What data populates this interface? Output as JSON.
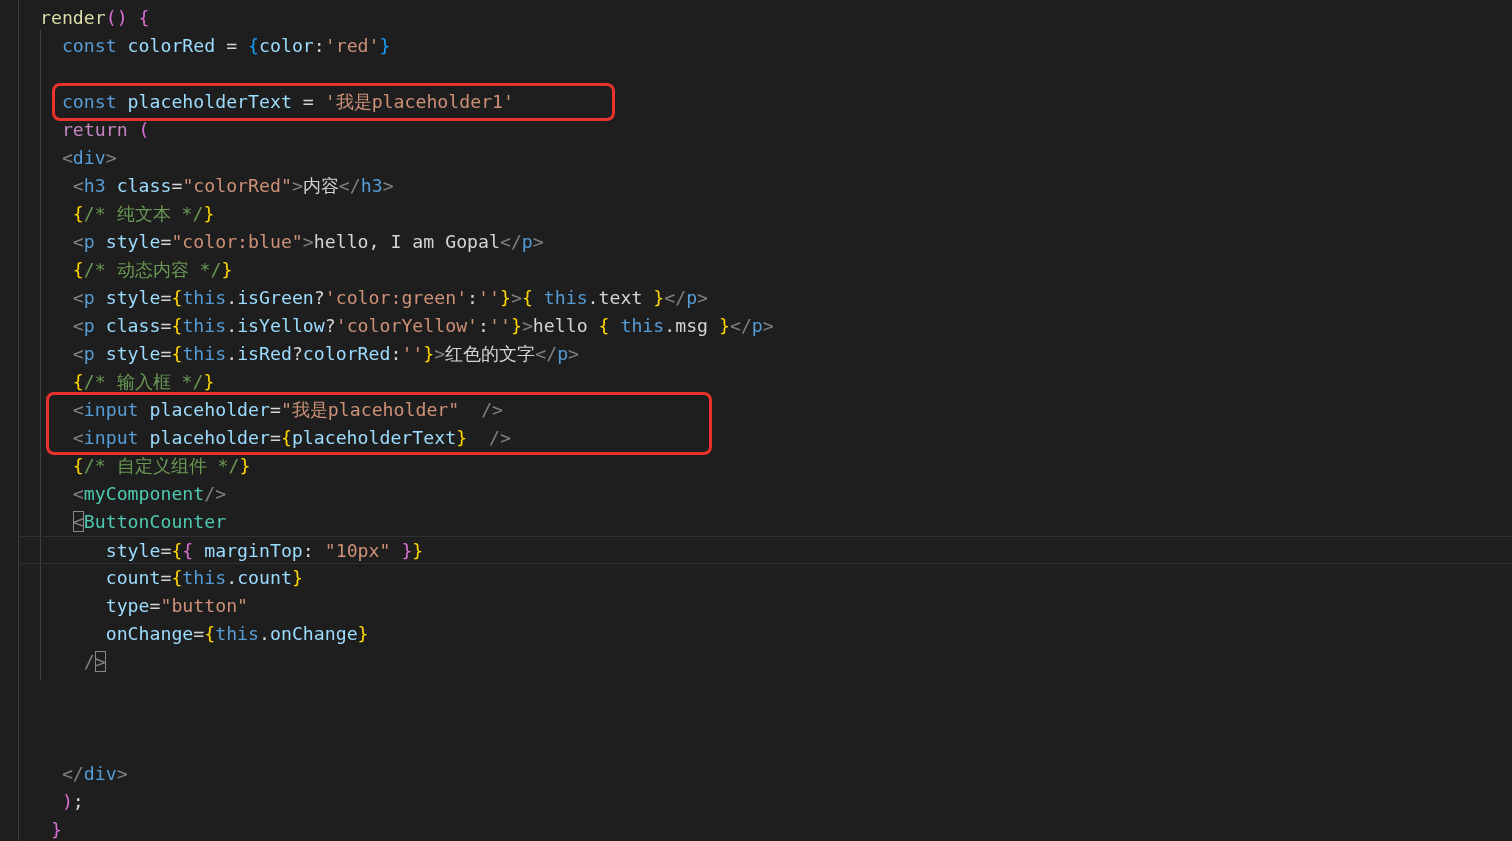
{
  "editor": {
    "lines": [
      {
        "kind": "code",
        "tokens": [
          {
            "kind": "fn",
            "text": "render"
          },
          {
            "kind": "purple",
            "text": "() "
          },
          {
            "kind": "purple",
            "text": "{"
          }
        ]
      },
      {
        "kind": "code",
        "tokens": [
          {
            "kind": "kw",
            "text": "  const "
          },
          {
            "kind": "var",
            "text": "colorRed"
          },
          {
            "kind": "plain",
            "text": " = "
          },
          {
            "kind": "brace2",
            "text": "{"
          },
          {
            "kind": "var",
            "text": "color"
          },
          {
            "kind": "plain",
            "text": ":"
          },
          {
            "kind": "str",
            "text": "'red'"
          },
          {
            "kind": "brace2",
            "text": "}"
          }
        ]
      },
      {
        "kind": "blank"
      },
      {
        "kind": "code",
        "boxed": true,
        "tokens": [
          {
            "kind": "kw",
            "text": "  const "
          },
          {
            "kind": "var",
            "text": "placeholderText"
          },
          {
            "kind": "plain",
            "text": " = "
          },
          {
            "kind": "str",
            "text": "'我是placeholder1'"
          }
        ]
      },
      {
        "kind": "code",
        "tokens": [
          {
            "kind": "ctrl",
            "text": "  return "
          },
          {
            "kind": "purple",
            "text": "("
          }
        ]
      },
      {
        "kind": "code",
        "tokens": [
          {
            "kind": "punct",
            "text": "  <"
          },
          {
            "kind": "tag",
            "text": "div"
          },
          {
            "kind": "punct",
            "text": ">"
          }
        ]
      },
      {
        "kind": "code",
        "tokens": [
          {
            "kind": "punct",
            "text": "   <"
          },
          {
            "kind": "tag",
            "text": "h3 "
          },
          {
            "kind": "var",
            "text": "class"
          },
          {
            "kind": "plain",
            "text": "="
          },
          {
            "kind": "str",
            "text": "\"colorRed\""
          },
          {
            "kind": "punct",
            "text": ">"
          },
          {
            "kind": "plain",
            "text": "内容"
          },
          {
            "kind": "punct",
            "text": "</"
          },
          {
            "kind": "tag",
            "text": "h3"
          },
          {
            "kind": "punct",
            "text": ">"
          }
        ]
      },
      {
        "kind": "code",
        "tokens": [
          {
            "kind": "yellow",
            "text": "   {"
          },
          {
            "kind": "comment",
            "text": "/* 纯文本 */"
          },
          {
            "kind": "yellow",
            "text": "}"
          }
        ]
      },
      {
        "kind": "code",
        "tokens": [
          {
            "kind": "punct",
            "text": "   <"
          },
          {
            "kind": "tag",
            "text": "p "
          },
          {
            "kind": "var",
            "text": "style"
          },
          {
            "kind": "plain",
            "text": "="
          },
          {
            "kind": "str",
            "text": "\"color:blue\""
          },
          {
            "kind": "punct",
            "text": ">"
          },
          {
            "kind": "plain",
            "text": "hello, I am Gopal"
          },
          {
            "kind": "punct",
            "text": "</"
          },
          {
            "kind": "tag",
            "text": "p"
          },
          {
            "kind": "punct",
            "text": ">"
          }
        ]
      },
      {
        "kind": "code",
        "tokens": [
          {
            "kind": "yellow",
            "text": "   {"
          },
          {
            "kind": "comment",
            "text": "/* 动态内容 */"
          },
          {
            "kind": "yellow",
            "text": "}"
          }
        ]
      },
      {
        "kind": "code",
        "tokens": [
          {
            "kind": "punct",
            "text": "   <"
          },
          {
            "kind": "tag",
            "text": "p "
          },
          {
            "kind": "var",
            "text": "style"
          },
          {
            "kind": "plain",
            "text": "="
          },
          {
            "kind": "yellow",
            "text": "{"
          },
          {
            "kind": "kw",
            "text": "this"
          },
          {
            "kind": "plain",
            "text": "."
          },
          {
            "kind": "var",
            "text": "isGreen"
          },
          {
            "kind": "plain",
            "text": "?"
          },
          {
            "kind": "str",
            "text": "'color:green'"
          },
          {
            "kind": "plain",
            "text": ":"
          },
          {
            "kind": "str",
            "text": "''"
          },
          {
            "kind": "yellow",
            "text": "}"
          },
          {
            "kind": "punct",
            "text": ">"
          },
          {
            "kind": "yellow",
            "text": "{ "
          },
          {
            "kind": "kw",
            "text": "this"
          },
          {
            "kind": "plain",
            "text": ".text "
          },
          {
            "kind": "yellow",
            "text": "}"
          },
          {
            "kind": "punct",
            "text": "</"
          },
          {
            "kind": "tag",
            "text": "p"
          },
          {
            "kind": "punct",
            "text": ">"
          }
        ]
      },
      {
        "kind": "code",
        "tokens": [
          {
            "kind": "punct",
            "text": "   <"
          },
          {
            "kind": "tag",
            "text": "p "
          },
          {
            "kind": "var",
            "text": "class"
          },
          {
            "kind": "plain",
            "text": "="
          },
          {
            "kind": "yellow",
            "text": "{"
          },
          {
            "kind": "kw",
            "text": "this"
          },
          {
            "kind": "plain",
            "text": "."
          },
          {
            "kind": "var",
            "text": "isYellow"
          },
          {
            "kind": "plain",
            "text": "?"
          },
          {
            "kind": "str",
            "text": "'colorYellow'"
          },
          {
            "kind": "plain",
            "text": ":"
          },
          {
            "kind": "str",
            "text": "''"
          },
          {
            "kind": "yellow",
            "text": "}"
          },
          {
            "kind": "punct",
            "text": ">"
          },
          {
            "kind": "plain",
            "text": "hello "
          },
          {
            "kind": "yellow",
            "text": "{ "
          },
          {
            "kind": "kw",
            "text": "this"
          },
          {
            "kind": "plain",
            "text": ".msg "
          },
          {
            "kind": "yellow",
            "text": "}"
          },
          {
            "kind": "punct",
            "text": "</"
          },
          {
            "kind": "tag",
            "text": "p"
          },
          {
            "kind": "punct",
            "text": ">"
          }
        ]
      },
      {
        "kind": "code",
        "tokens": [
          {
            "kind": "punct",
            "text": "   <"
          },
          {
            "kind": "tag",
            "text": "p "
          },
          {
            "kind": "var",
            "text": "style"
          },
          {
            "kind": "plain",
            "text": "="
          },
          {
            "kind": "yellow",
            "text": "{"
          },
          {
            "kind": "kw",
            "text": "this"
          },
          {
            "kind": "plain",
            "text": "."
          },
          {
            "kind": "var",
            "text": "isRed"
          },
          {
            "kind": "plain",
            "text": "?"
          },
          {
            "kind": "var",
            "text": "colorRed"
          },
          {
            "kind": "plain",
            "text": ":"
          },
          {
            "kind": "str",
            "text": "''"
          },
          {
            "kind": "yellow",
            "text": "}"
          },
          {
            "kind": "punct",
            "text": ">"
          },
          {
            "kind": "plain",
            "text": "红色的文字"
          },
          {
            "kind": "punct",
            "text": "</"
          },
          {
            "kind": "tag",
            "text": "p"
          },
          {
            "kind": "punct",
            "text": ">"
          }
        ]
      },
      {
        "kind": "code",
        "tokens": [
          {
            "kind": "yellow",
            "text": "   {"
          },
          {
            "kind": "comment",
            "text": "/* 输入框 */"
          },
          {
            "kind": "yellow",
            "text": "}"
          }
        ]
      },
      {
        "kind": "code",
        "boxed": true,
        "tokens": [
          {
            "kind": "punct",
            "text": "   <"
          },
          {
            "kind": "tag",
            "text": "input "
          },
          {
            "kind": "var",
            "text": "placeholder"
          },
          {
            "kind": "plain",
            "text": "="
          },
          {
            "kind": "str",
            "text": "\"我是placeholder\"  "
          },
          {
            "kind": "punct",
            "text": "/>"
          }
        ]
      },
      {
        "kind": "code",
        "boxed": true,
        "tokens": [
          {
            "kind": "punct",
            "text": "   <"
          },
          {
            "kind": "tag",
            "text": "input "
          },
          {
            "kind": "var",
            "text": "placeholder"
          },
          {
            "kind": "plain",
            "text": "="
          },
          {
            "kind": "yellow",
            "text": "{"
          },
          {
            "kind": "var",
            "text": "placeholderText"
          },
          {
            "kind": "yellow",
            "text": "}  "
          },
          {
            "kind": "punct",
            "text": "/>"
          }
        ]
      },
      {
        "kind": "code",
        "tokens": [
          {
            "kind": "yellow",
            "text": "   {"
          },
          {
            "kind": "comment",
            "text": "/* 自定义组件 */"
          },
          {
            "kind": "yellow",
            "text": "}"
          }
        ]
      },
      {
        "kind": "code",
        "tokens": [
          {
            "kind": "punct",
            "text": "   <"
          },
          {
            "kind": "component",
            "text": "myComponent"
          },
          {
            "kind": "punct",
            "text": "/>"
          }
        ]
      },
      {
        "kind": "code",
        "tokens": [
          {
            "kind": "punct",
            "text": "   <",
            "match": true
          },
          {
            "kind": "component",
            "text": "ButtonCounter"
          }
        ]
      },
      {
        "kind": "code",
        "current": true,
        "tokens": [
          {
            "kind": "var",
            "text": "      style"
          },
          {
            "kind": "plain",
            "text": "="
          },
          {
            "kind": "yellow",
            "text": "{"
          },
          {
            "kind": "purple",
            "text": "{ "
          },
          {
            "kind": "var",
            "text": "marginTop"
          },
          {
            "kind": "plain",
            "text": ": "
          },
          {
            "kind": "str",
            "text": "\"10px\" "
          },
          {
            "kind": "purple",
            "text": "}"
          },
          {
            "kind": "yellow",
            "text": "}"
          }
        ]
      },
      {
        "kind": "code",
        "tokens": [
          {
            "kind": "var",
            "text": "      count"
          },
          {
            "kind": "plain",
            "text": "="
          },
          {
            "kind": "yellow",
            "text": "{"
          },
          {
            "kind": "kw",
            "text": "this"
          },
          {
            "kind": "plain",
            "text": "."
          },
          {
            "kind": "var",
            "text": "count"
          },
          {
            "kind": "yellow",
            "text": "}"
          }
        ]
      },
      {
        "kind": "code",
        "tokens": [
          {
            "kind": "var",
            "text": "      type"
          },
          {
            "kind": "plain",
            "text": "="
          },
          {
            "kind": "str",
            "text": "\"button\""
          }
        ]
      },
      {
        "kind": "code",
        "tokens": [
          {
            "kind": "var",
            "text": "      onChange"
          },
          {
            "kind": "plain",
            "text": "="
          },
          {
            "kind": "yellow",
            "text": "{"
          },
          {
            "kind": "kw",
            "text": "this"
          },
          {
            "kind": "plain",
            "text": "."
          },
          {
            "kind": "var",
            "text": "onChange"
          },
          {
            "kind": "yellow",
            "text": "}"
          }
        ]
      },
      {
        "kind": "code",
        "tokens": [
          {
            "kind": "punct",
            "text": "    /"
          },
          {
            "kind": "punct",
            "text": ">",
            "match": true
          }
        ]
      },
      {
        "kind": "blank"
      },
      {
        "kind": "blank"
      },
      {
        "kind": "blank"
      },
      {
        "kind": "code",
        "tokens": [
          {
            "kind": "punct",
            "text": "  </"
          },
          {
            "kind": "tag",
            "text": "div"
          },
          {
            "kind": "punct",
            "text": ">"
          }
        ]
      },
      {
        "kind": "code",
        "tokens": [
          {
            "kind": "purple",
            "text": "  )"
          },
          {
            "kind": "plain",
            "text": ";"
          }
        ]
      },
      {
        "kind": "code",
        "tokens": [
          {
            "kind": "purple",
            "text": " }"
          }
        ]
      }
    ]
  }
}
